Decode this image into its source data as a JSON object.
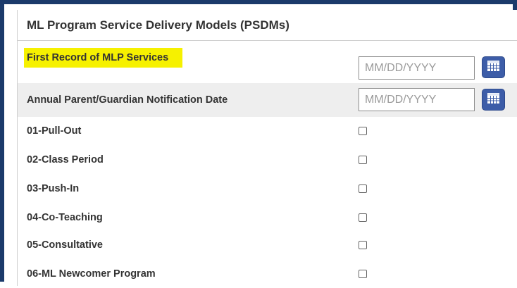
{
  "panel": {
    "title": "ML Program Service Delivery Models (PSDMs)"
  },
  "date_fields": [
    {
      "label": "First Record of MLP Services",
      "placeholder": "MM/DD/YYYY",
      "value": "",
      "highlighted": true,
      "highlight_color": "#f6f100",
      "icon": "calendar-icon"
    },
    {
      "label": "Annual Parent/Guardian Notification Date",
      "placeholder": "MM/DD/YYYY",
      "value": "",
      "highlighted": false,
      "icon": "calendar-icon"
    }
  ],
  "checkbox_items": [
    {
      "label": "01-Pull-Out",
      "checked": false
    },
    {
      "label": "02-Class Period",
      "checked": false
    },
    {
      "label": "03-Push-In",
      "checked": false
    },
    {
      "label": "04-Co-Teaching",
      "checked": false
    },
    {
      "label": "05-Consultative",
      "checked": false
    },
    {
      "label": "06-ML Newcomer Program",
      "checked": false
    }
  ],
  "colors": {
    "frame_border": "#1b3a6b",
    "calendar_button": "#3d5da8",
    "shaded_row": "#eeeeee",
    "label_text": "#333333"
  }
}
